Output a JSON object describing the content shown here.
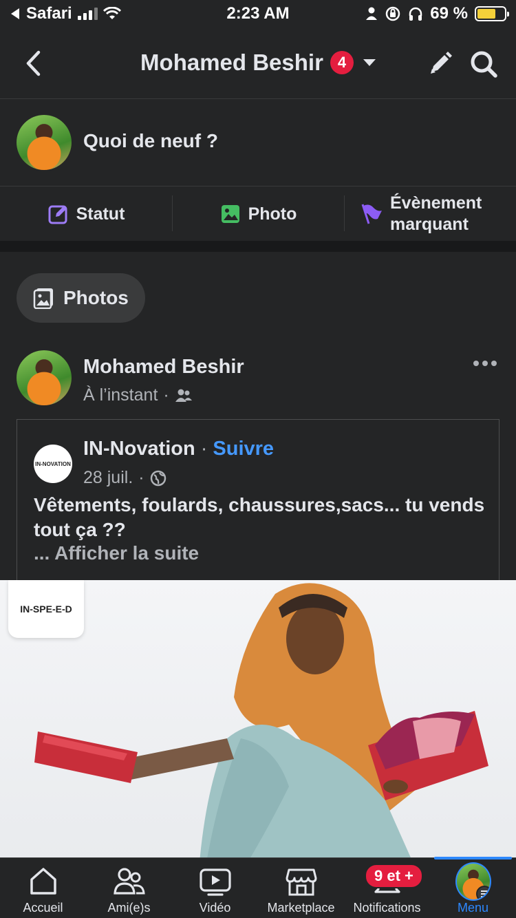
{
  "status_bar": {
    "back_app": "Safari",
    "time": "2:23 AM",
    "battery_percent": "69 %",
    "battery_level": 0.69
  },
  "header": {
    "title": "Mohamed Beshir",
    "badge_count": "4",
    "icons": [
      "chevron-left-icon",
      "chevron-down-icon",
      "pencil-icon",
      "search-icon"
    ]
  },
  "composer": {
    "prompt": "Quoi de neuf ?",
    "actions": [
      {
        "label": "Statut",
        "icon": "edit-icon",
        "color": "#9d7cf5"
      },
      {
        "label": "Photo",
        "icon": "photo-icon",
        "color": "#45bd62"
      },
      {
        "label": "Évènement marquant",
        "icon": "flag-icon",
        "color": "#8c5cf5"
      }
    ]
  },
  "feed": {
    "filter_pill": "Photos",
    "post": {
      "author": "Mohamed Beshir",
      "time": "À l’instant",
      "audience_icon": "friends-icon",
      "shared": {
        "page_name": "IN-Novation",
        "follow_label": "Suivre",
        "date": "28 juil.",
        "privacy_icon": "globe-icon",
        "logo_text": "IN-NOVATION",
        "text": "Vêtements, foulards, chaussures,sacs... tu vends tout ça ??",
        "see_more": "... Afficher la suite"
      },
      "photo": {
        "brand_logo_text": "IN-SPE-E-D"
      }
    }
  },
  "tabbar": {
    "accent": "#2d88ff",
    "tabs": [
      {
        "label": "Accueil",
        "icon": "home-icon"
      },
      {
        "label": "Ami(e)s",
        "icon": "friends-icon"
      },
      {
        "label": "Vidéo",
        "icon": "video-icon"
      },
      {
        "label": "Marketplace",
        "icon": "marketplace-icon"
      },
      {
        "label": "Notifications",
        "icon": "bell-icon",
        "badge": "9 et +"
      },
      {
        "label": "Menu",
        "icon": "menu-icon",
        "active": true
      }
    ]
  }
}
